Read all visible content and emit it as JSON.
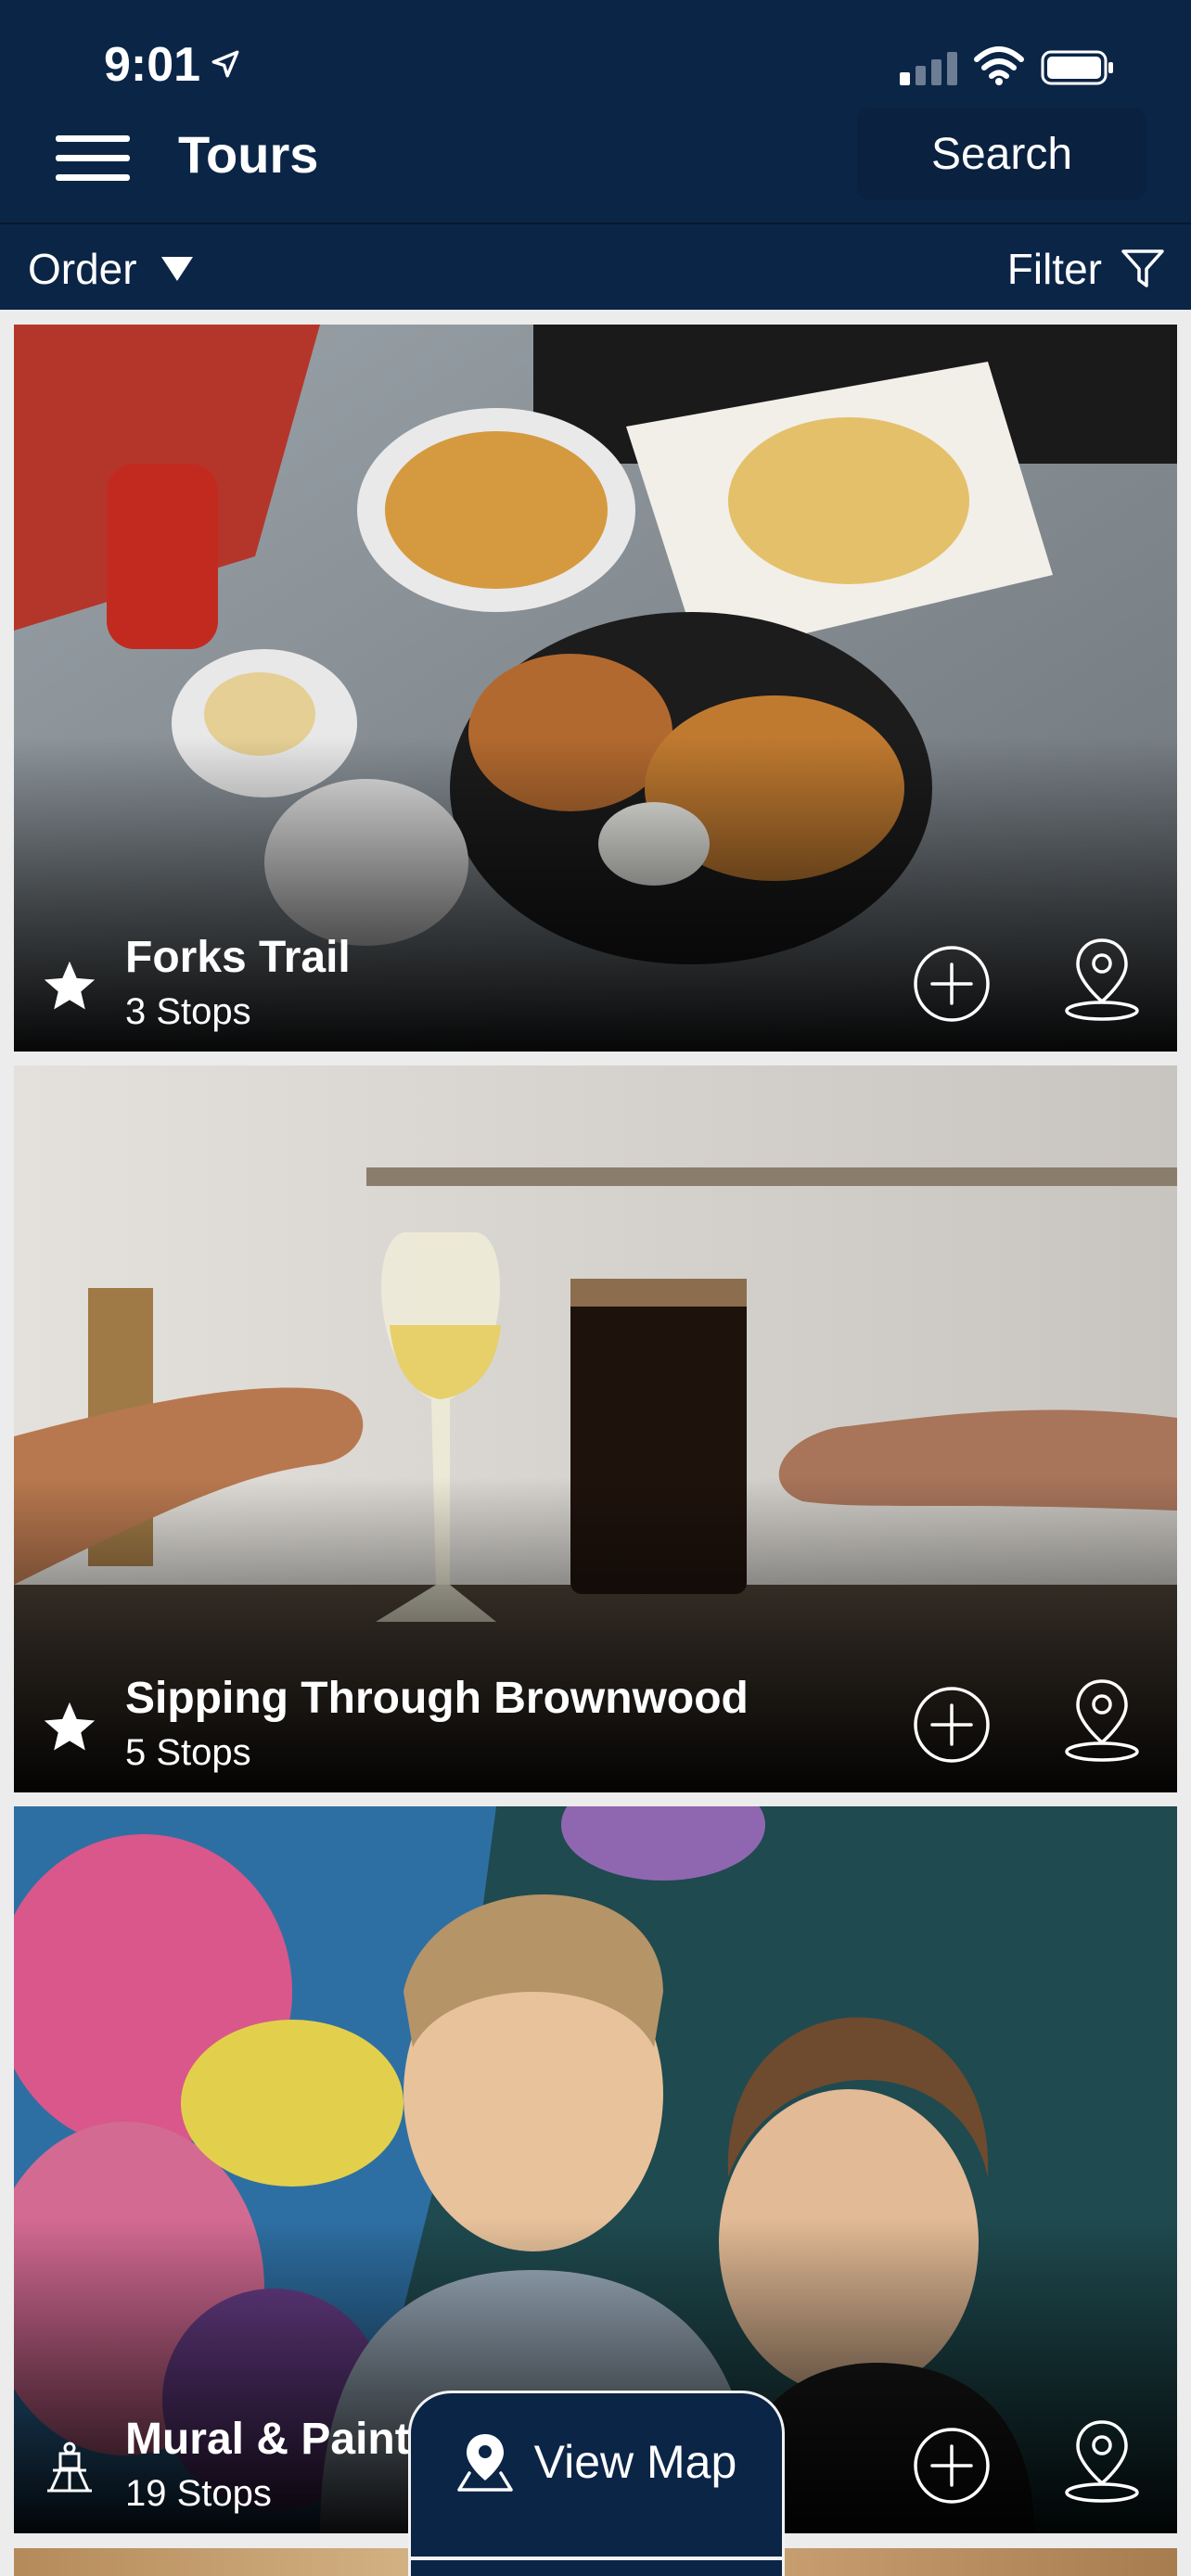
{
  "status_bar": {
    "time": "9:01"
  },
  "header": {
    "title": "Tours",
    "search_label": "Search"
  },
  "toolbar": {
    "order_label": "Order",
    "filter_label": "Filter"
  },
  "tours": [
    {
      "title": "Forks Trail",
      "stops": "3 Stops",
      "icon": "star-icon"
    },
    {
      "title": "Sipping Through Brownwood",
      "stops": "5 Stops",
      "icon": "star-icon"
    },
    {
      "title": "Mural & Paint",
      "stops": "19 Stops",
      "icon": "sculpture-icon"
    }
  ],
  "view_map": {
    "label": "View Map"
  },
  "colors": {
    "header": "#0b2547",
    "background": "#ececec",
    "text": "#ffffff"
  }
}
